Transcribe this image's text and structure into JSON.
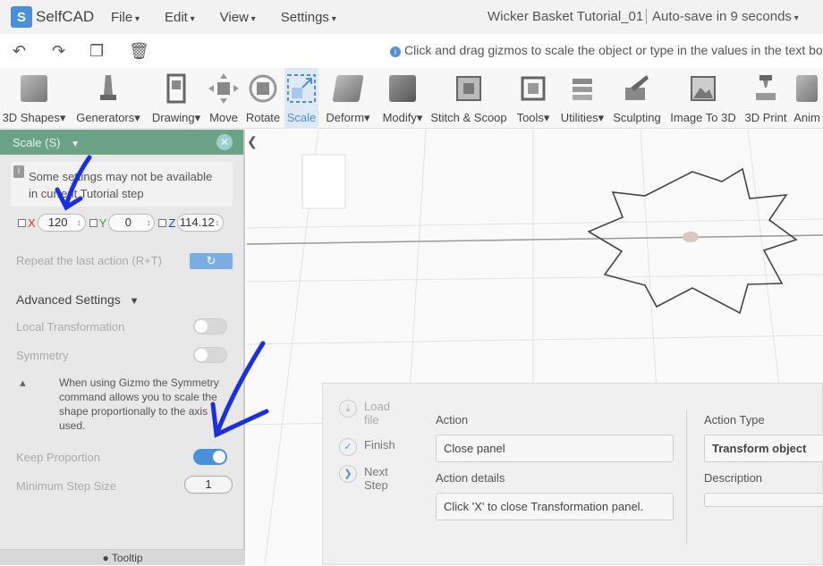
{
  "app": {
    "logo_letter": "S",
    "logo_text": "SelfCAD",
    "doc_title": "Wicker Basket Tutorial_01",
    "autosave": "Auto-save in 9 seconds"
  },
  "menu": [
    "File",
    "Edit",
    "View",
    "Settings"
  ],
  "quick_icons": [
    "undo-icon",
    "redo-icon",
    "copy-icon",
    "trash-icon"
  ],
  "hint": "Click and drag gizmos to scale the object or type in the values in the text boxe",
  "toolbar": [
    {
      "label": "3D Shapes▾",
      "icon": "cube-icon"
    },
    {
      "label": "Generators▾",
      "icon": "generator-icon"
    },
    {
      "label": "Drawing▾",
      "icon": "drawing-icon"
    },
    {
      "label": "Move",
      "icon": "move-icon"
    },
    {
      "label": "Rotate",
      "icon": "rotate-icon"
    },
    {
      "label": "Scale",
      "icon": "scale-icon"
    },
    {
      "label": "Deform▾",
      "icon": "deform-icon"
    },
    {
      "label": "Modify▾",
      "icon": "modify-icon"
    },
    {
      "label": "Stitch & Scoop",
      "icon": "stitch-icon"
    },
    {
      "label": "Tools▾",
      "icon": "tools-icon"
    },
    {
      "label": "Utilities▾",
      "icon": "utilities-icon"
    },
    {
      "label": "Sculpting",
      "icon": "sculpting-icon"
    },
    {
      "label": "Image To 3D",
      "icon": "image-to-3d-icon"
    },
    {
      "label": "3D Print",
      "icon": "printer-icon"
    },
    {
      "label": "Anim",
      "icon": "animation-icon"
    }
  ],
  "panel": {
    "title": "Scale (S)",
    "notice": "Some settings may not be available in current Tutorial step",
    "x_label": "X",
    "x_value": "120",
    "y_label": "Y",
    "y_value": "0",
    "z_label": "Z",
    "z_value": "114.12",
    "repeat": "Repeat the last action (R+T)",
    "advanced": "Advanced Settings",
    "local": "Local Transformation",
    "symmetry": "Symmetry",
    "symmetry_note": "When using Gizmo the Symmetry command allows you to scale the shape proportionally to the axis used.",
    "keep": "Keep Proportion",
    "min_step": "Minimum Step Size",
    "min_step_value": "1",
    "tooltip": "Tooltip"
  },
  "tutorial": {
    "steps": [
      "Load file",
      "Finish",
      "Next Step"
    ],
    "action_label": "Action",
    "action_value": "Close panel",
    "details_label": "Action details",
    "details_value": "Click 'X' to close Transformation panel.",
    "type_label": "Action Type",
    "type_value": "Transform object",
    "desc_label": "Description"
  },
  "colors": {
    "accent": "#4a90d9",
    "panel_header": "#6aa385",
    "annotation": "#1a2fe0"
  }
}
